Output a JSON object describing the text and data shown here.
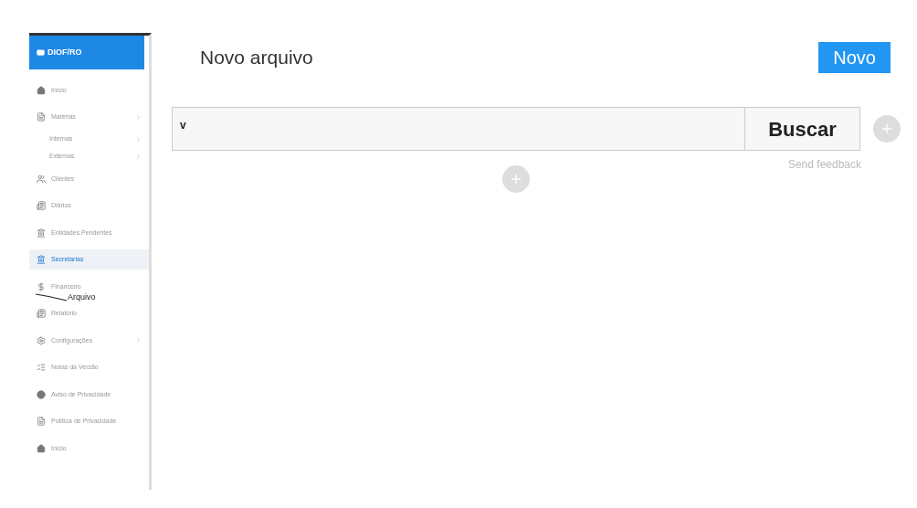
{
  "sidebar": {
    "brand": "DIOF/RO",
    "items": [
      {
        "label": "Início",
        "kind": "home",
        "arrow": false,
        "selected": false
      },
      {
        "label": "Matérias",
        "kind": "file",
        "arrow": true,
        "selected": false,
        "children": [
          {
            "label": "Internas",
            "arrow": true
          },
          {
            "label": "Externas",
            "arrow": true
          }
        ]
      },
      {
        "label": "Clientes",
        "kind": "users",
        "arrow": false,
        "selected": false
      },
      {
        "label": "Diários",
        "kind": "news",
        "arrow": false,
        "selected": false
      },
      {
        "label": "Entidades Pendentes",
        "kind": "bank",
        "arrow": false,
        "selected": false
      },
      {
        "label": "Secretarias",
        "kind": "bank",
        "arrow": false,
        "selected": true
      },
      {
        "label": "Financeiro",
        "kind": "dollar",
        "arrow": false,
        "selected": false
      },
      {
        "label": "Relatório",
        "kind": "news",
        "arrow": false,
        "selected": false
      },
      {
        "label": "Configurações",
        "kind": "gear",
        "arrow": true,
        "selected": false
      },
      {
        "label": "Notas da Versão",
        "kind": "list",
        "arrow": false,
        "selected": false
      },
      {
        "label": "Aviso de Privacidade",
        "kind": "circle",
        "arrow": false,
        "selected": false
      },
      {
        "label": "Política de Privacidade",
        "kind": "file",
        "arrow": false,
        "selected": false
      },
      {
        "label": "Início",
        "kind": "home",
        "arrow": false,
        "selected": false
      }
    ]
  },
  "annotation": "Arquivo",
  "main": {
    "title": "Novo arquivo",
    "new_button": "Novo",
    "search": {
      "value": "v"
    },
    "search_button": "Buscar",
    "feedback": "Send feedback"
  }
}
